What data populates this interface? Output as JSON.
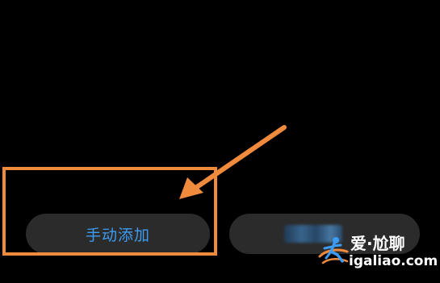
{
  "buttons": {
    "manual_add_label": "手动添加"
  },
  "watermark": {
    "brand": "爱·尬聊",
    "url": "igaliao.com"
  },
  "colors": {
    "background": "#000000",
    "button_bg": "#2b2b2b",
    "button_text": "#3d9cf2",
    "annotation": "#f08a3c"
  },
  "icons": {
    "annotation_arrow": "arrow-pointing-down-left-icon",
    "watermark_logo": "runner-logo-icon"
  }
}
